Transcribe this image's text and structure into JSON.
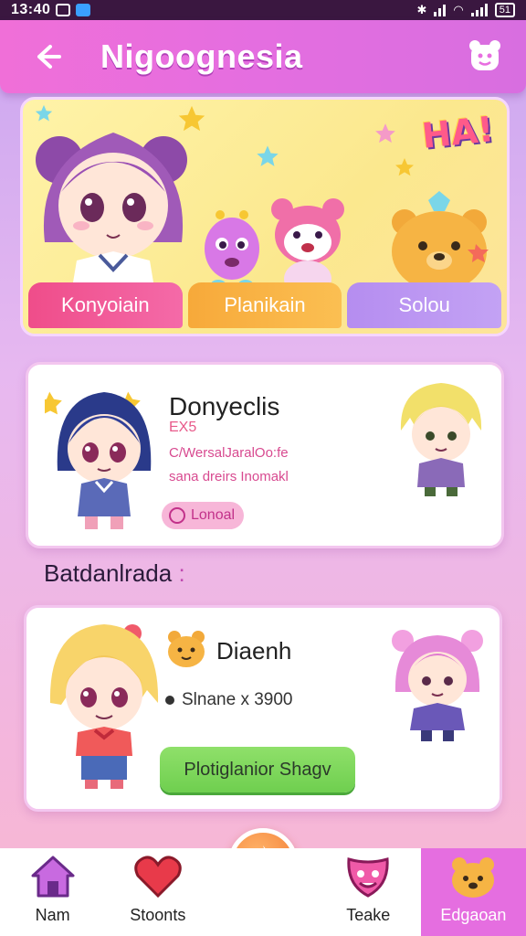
{
  "status_bar": {
    "time": "13:40",
    "battery": "51"
  },
  "header": {
    "title": "Nigoognesia"
  },
  "banner": {
    "sticker_text": "HA!",
    "tabs": [
      {
        "label": "Konyoiain"
      },
      {
        "label": "Planikain"
      },
      {
        "label": "Solou"
      }
    ]
  },
  "featured": {
    "name": "Donyeclis",
    "code": "EX5",
    "line1": "C/WersalJaralOo:fe",
    "line2": "sana dreirs Inomakl",
    "chip_label": "Lonoal"
  },
  "section": {
    "title": "Batdanlrada",
    "dots": ":"
  },
  "item": {
    "name": "Diaenh",
    "price": "Slnane x 3900",
    "button_label": "Plotiglanior Shagv"
  },
  "nav": [
    {
      "label": "Nam",
      "icon": "home-icon"
    },
    {
      "label": "Stoonts",
      "icon": "heart-icon"
    },
    {
      "label": "",
      "icon": "flame-icon"
    },
    {
      "label": "Teake",
      "icon": "mask-icon"
    },
    {
      "label": "Edgaoan",
      "icon": "bear-icon"
    }
  ],
  "colors": {
    "header": "#e86ee0",
    "accent_green": "#7fd85a",
    "pink": "#ef4d8a",
    "orange": "#f7a93a",
    "lavender": "#b58df0"
  }
}
